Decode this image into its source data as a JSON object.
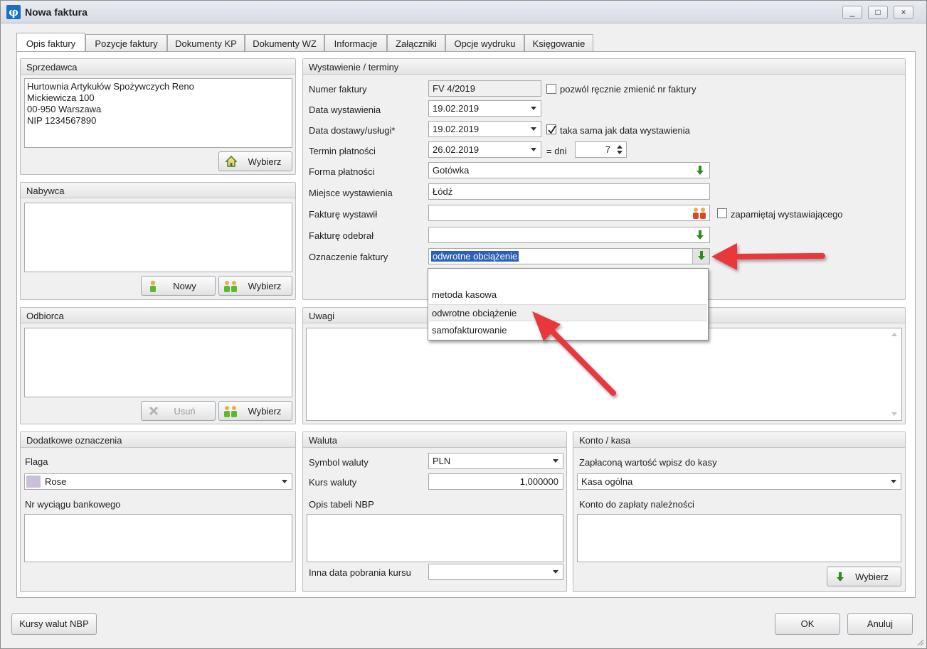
{
  "window": {
    "title": "Nowa faktura",
    "minimize": "_",
    "maximize": "□",
    "close": "×"
  },
  "tabs": [
    "Opis faktury",
    "Pozycje faktury",
    "Dokumenty KP",
    "Dokumenty WZ",
    "Informacje",
    "Załączniki",
    "Opcje wydruku",
    "Księgowanie"
  ],
  "seller": {
    "title": "Sprzedawca",
    "lines": [
      "Hurtownia Artykułów Spożywczych Reno",
      "Mickiewicza 100",
      "00-950 Warszawa",
      "NIP 1234567890"
    ],
    "choose": "Wybierz"
  },
  "buyer": {
    "title": "Nabywca",
    "new": "Nowy",
    "choose": "Wybierz"
  },
  "receiver": {
    "title": "Odbiorca",
    "remove": "Usuń",
    "choose": "Wybierz"
  },
  "issue": {
    "title": "Wystawienie / terminy",
    "number_label": "Numer faktury",
    "number": "FV 4/2019",
    "manual_label": "pozwól ręcznie zmienić nr faktury",
    "issue_date_label": "Data wystawienia",
    "issue_date": "19.02.2019",
    "delivery_label": "Data dostawy/usługi*",
    "delivery_date": "19.02.2019",
    "same_label": "taka sama jak data wystawienia",
    "due_label": "Termin płatności",
    "due_date": "26.02.2019",
    "days_label": "= dni",
    "days": "7",
    "payment_label": "Forma płatności",
    "payment": "Gotówka",
    "place_label": "Miejsce wystawienia",
    "place": "Łódź",
    "issued_by_label": "Fakturę wystawił",
    "issued_by": "",
    "remember_label": "zapamiętaj wystawiającego",
    "received_by_label": "Fakturę odebrał",
    "received_by": "",
    "marking_label": "Oznaczenie faktury",
    "marking": "odwrotne obciążenie"
  },
  "marking_options": [
    "",
    "metoda kasowa",
    "odwrotne obciążenie",
    "samofakturowanie"
  ],
  "notes": {
    "title": "Uwagi"
  },
  "extra": {
    "title": "Dodatkowe oznaczenia",
    "flag_label": "Flaga",
    "flag": "Rose",
    "flag_color": "#c9bfd6",
    "statement_label": "Nr wyciągu bankowego"
  },
  "currency": {
    "title": "Waluta",
    "symbol_label": "Symbol waluty",
    "symbol": "PLN",
    "rate_label": "Kurs waluty",
    "rate": "1,000000",
    "nbp_label": "Opis tabeli NBP",
    "other_date_label": "Inna data pobrania kursu"
  },
  "account": {
    "title": "Konto / kasa",
    "cash_label": "Zapłaconą wartość wpisz do kasy",
    "cash": "Kasa ogólna",
    "account_label": "Konto do zapłaty należności",
    "choose": "Wybierz"
  },
  "footer": {
    "rates": "Kursy walut NBP",
    "ok": "OK",
    "cancel": "Anuluj"
  },
  "colors": {
    "accent_arrow": "#e8373a",
    "green_icon": "#2e8b1e",
    "selection": "#2b5fb8"
  }
}
